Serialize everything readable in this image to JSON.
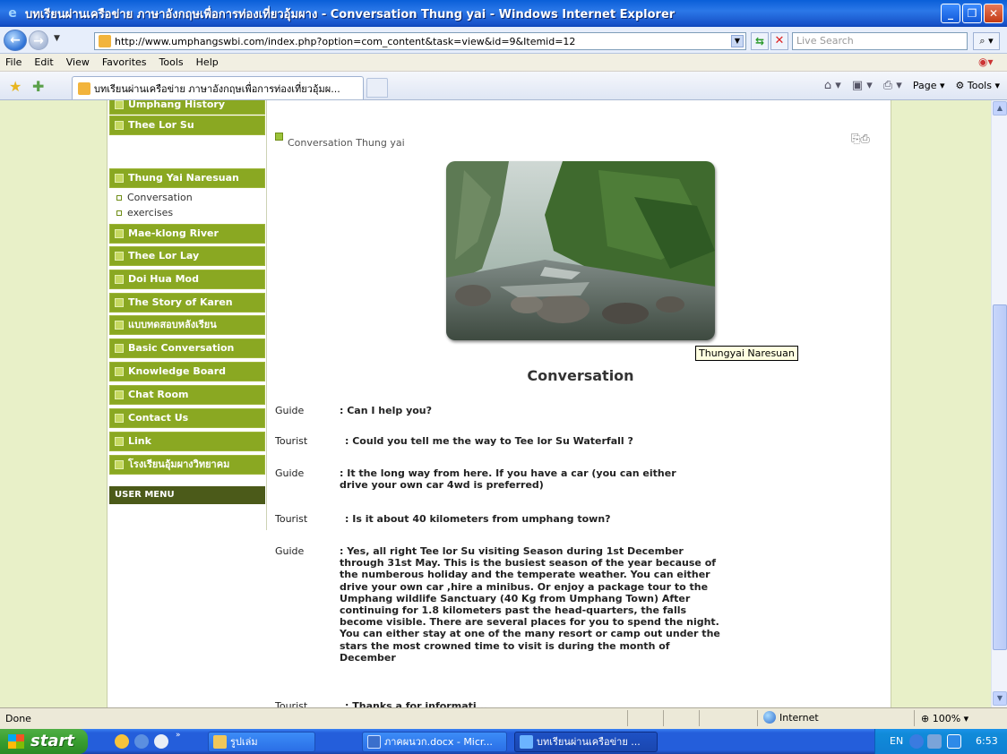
{
  "window": {
    "title": "บทเรียนผ่านเครือข่าย ภาษาอังกฤษเพื่อการท่องเที่ยวอุ้มผาง - Conversation Thung yai - Windows Internet Explorer",
    "minimize": "_",
    "maximize": "❐",
    "close": "✕"
  },
  "address": {
    "url": "http://www.umphangswbi.com/index.php?option=com_content&task=view&id=9&Itemid=12",
    "search_placeholder": "Live Search"
  },
  "menu": [
    "File",
    "Edit",
    "View",
    "Favorites",
    "Tools",
    "Help"
  ],
  "tab": {
    "label": "บทเรียนผ่านเครือข่าย ภาษาอังกฤษเพื่อการท่องเที่ยวอุ้มผ...",
    "page_label": "Page",
    "tools_label": "Tools"
  },
  "sidebar": {
    "items": [
      {
        "label": "Umphang History"
      },
      {
        "label": "Thee Lor Su"
      },
      {
        "label": "Thung Yai Naresuan"
      },
      {
        "label": "Mae-klong River"
      },
      {
        "label": "Thee Lor Lay"
      },
      {
        "label": "Doi Hua Mod"
      },
      {
        "label": "The Story of Karen"
      },
      {
        "label": "แบบทดสอบหลังเรียน"
      },
      {
        "label": "Basic Conversation"
      },
      {
        "label": "Knowledge Board"
      },
      {
        "label": "Chat Room"
      },
      {
        "label": "Contact Us"
      },
      {
        "label": "Link"
      },
      {
        "label": "โรงเรียนอุ้มผางวิทยาคม"
      }
    ],
    "sub_items": [
      {
        "label": "Conversation"
      },
      {
        "label": "exercises"
      }
    ],
    "user_menu": "USER MENU"
  },
  "article": {
    "breadcrumb": "Conversation Thung yai",
    "image_tooltip": "Thungyai Naresuan",
    "heading": "Conversation",
    "dialogue": [
      {
        "speaker": "Guide",
        "text": ": Can I help you?"
      },
      {
        "speaker": "Tourist",
        "text": ": Could you tell me the way to Tee lor Su Waterfall ?"
      },
      {
        "speaker": "Guide",
        "text": ": It the long way from here. If you have a car (you can either drive your own car 4wd is preferred)"
      },
      {
        "speaker": "Tourist",
        "text": ": Is it about 40 kilometers from umphang town?"
      },
      {
        "speaker": "Guide",
        "text": ": Yes, all right Tee lor Su visiting Season during 1st December through 31st May. This is the busiest season of the year because of the numberous holiday and the temperate weather. You can either drive your own car ,hire a minibus. Or enjoy a package tour to the Umphang wildlife Sanctuary (40 Kg from Umphang Town) After continuing for 1.8 kilometers past the head-quarters, the falls become visible. There are several places for you to spend the night. You can either stay at one of the many resort or camp out under the stars the most crowned time to visit is during the month of December"
      },
      {
        "speaker": "Tourist",
        "text": ": Thanks a for informati..."
      }
    ]
  },
  "status": {
    "text": "Done",
    "zone": "Internet",
    "zoom": "100%"
  },
  "taskbar": {
    "start": "start",
    "tasks": [
      {
        "label": "รูปเล่ม"
      },
      {
        "label": "ภาคผนวก.docx - Micr..."
      },
      {
        "label": "บทเรียนผ่านเครือข่าย ..."
      }
    ],
    "lang": "EN",
    "clock": "6:53"
  }
}
